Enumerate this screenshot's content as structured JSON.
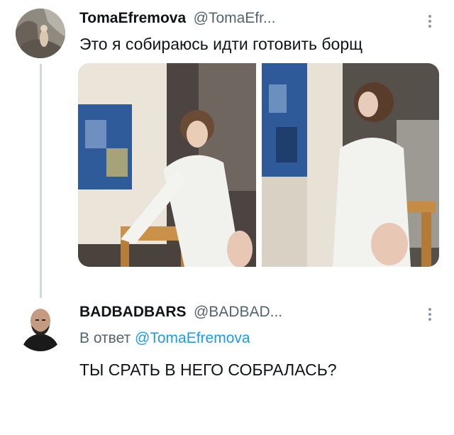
{
  "tweet": {
    "name": "TomaEfremova",
    "handle": "@TomaEfr...",
    "text": "Это я собираюсь идти готовить борщ"
  },
  "reply": {
    "name": "BADBADBARS",
    "handle": "@BADBAD...",
    "reply_prefix": "В ответ",
    "reply_to": "@TomaEfremova",
    "text": "ТЫ СРАТЬ В НЕГО СОБРАЛАСЬ?"
  },
  "icons": {
    "more": "more-vertical-icon"
  }
}
